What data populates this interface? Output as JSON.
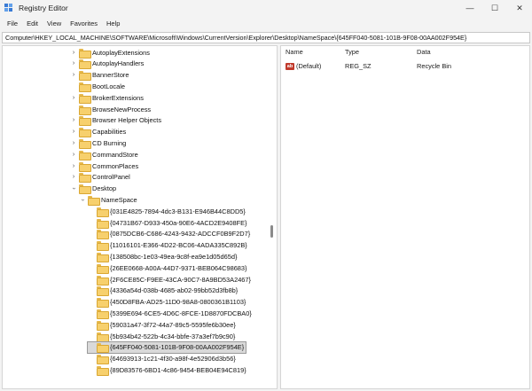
{
  "window": {
    "title": "Registry Editor",
    "controls": {
      "minimize": "—",
      "maximize": "☐",
      "close": "✕"
    }
  },
  "menu": [
    "File",
    "Edit",
    "View",
    "Favorites",
    "Help"
  ],
  "address": "Computer\\HKEY_LOCAL_MACHINE\\SOFTWARE\\Microsoft\\Windows\\CurrentVersion\\Explorer\\Desktop\\NameSpace\\{645FF040-5081-101B-9F08-00AA002F954E}",
  "tree": {
    "items": [
      {
        "label": "AutoplayExtensions",
        "expanded": false
      },
      {
        "label": "AutoplayHandlers",
        "expanded": false
      },
      {
        "label": "BannerStore",
        "expanded": false
      },
      {
        "label": "BootLocale",
        "expanded": null
      },
      {
        "label": "BrokerExtensions",
        "expanded": false
      },
      {
        "label": "BrowseNewProcess",
        "expanded": null
      },
      {
        "label": "Browser Helper Objects",
        "expanded": false
      },
      {
        "label": "Capabilities",
        "expanded": false
      },
      {
        "label": "CD Burning",
        "expanded": false
      },
      {
        "label": "CommandStore",
        "expanded": false
      },
      {
        "label": "CommonPlaces",
        "expanded": false
      },
      {
        "label": "ControlPanel",
        "expanded": false
      },
      {
        "label": "Desktop",
        "expanded": true
      },
      {
        "label": "NameSpace",
        "expanded": true
      },
      {
        "label": "{031E4825-7894-4dc3-B131-E946B44C8DD5}"
      },
      {
        "label": "{04731B67-D933-450a-90E6-4ACD2E9408FE}"
      },
      {
        "label": "{0875DCB6-C686-4243-9432-ADCCF0B9F2D7}"
      },
      {
        "label": "{11016101-E366-4D22-BC06-4ADA335C892B}"
      },
      {
        "label": "{138508bc-1e03-49ea-9c8f-ea9e1d05d65d}"
      },
      {
        "label": "{26EE0668-A00A-44D7-9371-BEB064C98683}"
      },
      {
        "label": "{2F6CE85C-F9EE-43CA-90C7-8A9BD53A2467}"
      },
      {
        "label": "{4336a54d-038b-4685-ab02-99bb52d3fb8b}"
      },
      {
        "label": "{450D8FBA-AD25-11D0-98A8-0800361B1103}"
      },
      {
        "label": "{5399E694-6CE5-4D6C-8FCE-1D8870FDCBA0}"
      },
      {
        "label": "{59031a47-3f72-44a7-89c5-5595fe6b30ee}"
      },
      {
        "label": "{5b934b42-522b-4c34-bbfe-37a3ef7b9c90}"
      },
      {
        "label": "{645FF040-5081-101B-9F08-00AA002F954E}",
        "selected": true
      },
      {
        "label": "{64693913-1c21-4f30-a98f-4e52906d3b56}"
      },
      {
        "label": "{89D83576-6BD1-4c86-9454-BEB04E94C819}"
      }
    ]
  },
  "values": {
    "columns": {
      "name": "Name",
      "type": "Type",
      "data": "Data"
    },
    "rows": [
      {
        "icon": "ab",
        "name": "(Default)",
        "type": "REG_SZ",
        "data": "Recycle Bin"
      }
    ]
  }
}
